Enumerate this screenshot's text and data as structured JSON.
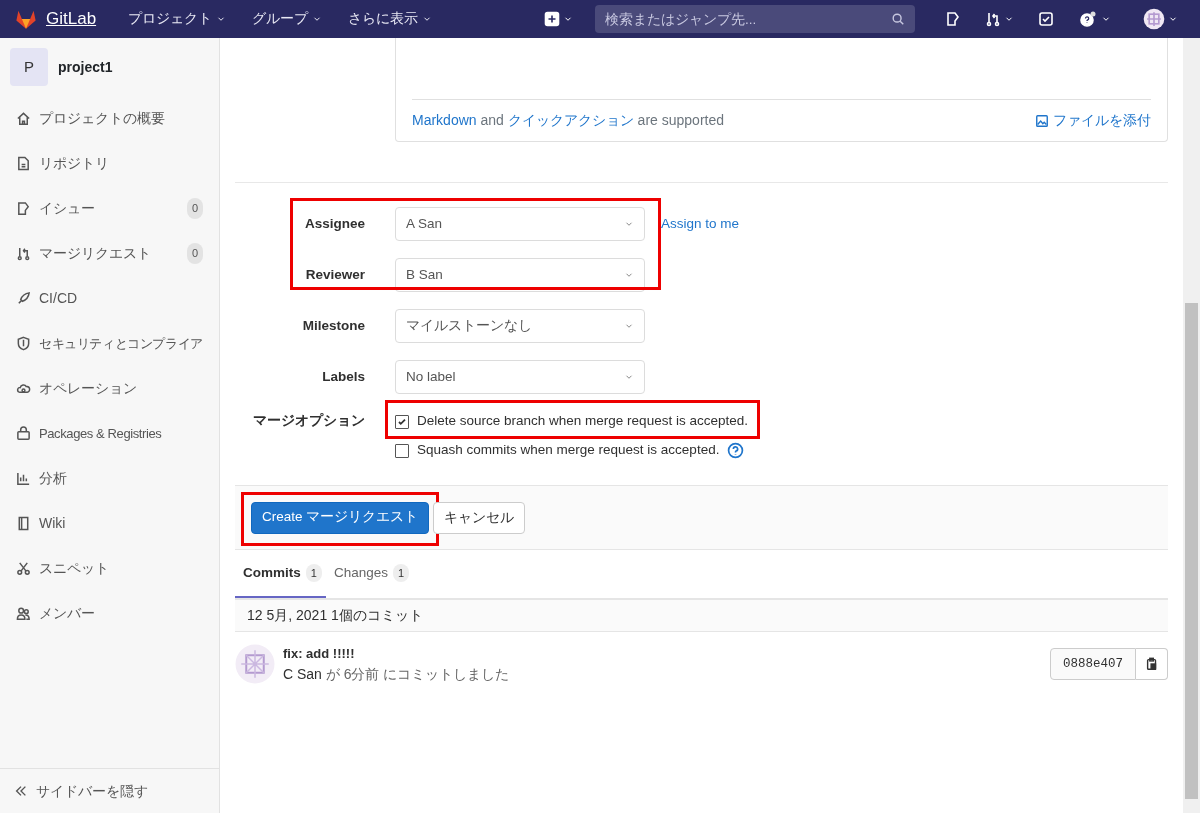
{
  "navbar": {
    "brand": "GitLab",
    "menus": [
      {
        "label": "プロジェクト"
      },
      {
        "label": "グループ"
      },
      {
        "label": "さらに表示"
      }
    ],
    "search": {
      "placeholder": "検索またはジャンプ先..."
    }
  },
  "sidebar": {
    "project": {
      "avatar": "P",
      "name": "project1"
    },
    "items": [
      {
        "label": "プロジェクトの概要"
      },
      {
        "label": "リポジトリ"
      },
      {
        "label": "イシュー",
        "count": "0"
      },
      {
        "label": "マージリクエスト",
        "count": "0"
      },
      {
        "label": "CI/CD"
      },
      {
        "label": "セキュリティとコンプライア"
      },
      {
        "label": "オペレーション"
      },
      {
        "label": "Packages & Registries"
      },
      {
        "label": "分析"
      },
      {
        "label": "Wiki"
      },
      {
        "label": "スニペット"
      },
      {
        "label": "メンバー"
      }
    ],
    "collapse": "サイドバーを隠す"
  },
  "editor_footer": {
    "segments": [
      {
        "text": "Markdown",
        "kind": "link"
      },
      {
        "text": " and ",
        "kind": "text"
      },
      {
        "text": "クイックアクション",
        "kind": "link"
      },
      {
        "text": " are supported",
        "kind": "text"
      }
    ],
    "attach": "ファイルを添付"
  },
  "field_groups": [
    {
      "highlighted": true,
      "fields": [
        {
          "label": "Assignee",
          "value": "A San",
          "action": "Assign to me"
        },
        {
          "label": "Reviewer",
          "value": "B San"
        }
      ]
    },
    {
      "highlighted": false,
      "fields": [
        {
          "label": "Milestone",
          "value": "マイルストーンなし"
        },
        {
          "label": "Labels",
          "value": "No label"
        }
      ]
    }
  ],
  "merge_options": {
    "label": "マージオプション",
    "options": [
      {
        "label": "Delete source branch when merge request is accepted.",
        "checked": true,
        "highlighted": true,
        "help": false
      },
      {
        "label": "Squash commits when merge request is accepted.",
        "checked": false,
        "highlighted": false,
        "help": true
      }
    ]
  },
  "actions": [
    {
      "label": "Create マージリクエスト",
      "kind": "primary",
      "highlighted": true
    },
    {
      "label": "キャンセル",
      "kind": "default",
      "highlighted": false
    }
  ],
  "tabs": [
    {
      "label": "Commits",
      "count": "1",
      "selected": true
    },
    {
      "label": "Changes",
      "count": "1",
      "selected": false
    }
  ],
  "commit_groups": [
    {
      "date": "12 5月, 2021 1個のコミット",
      "commits": [
        {
          "title": "fix: add !!!!!",
          "author": "C San",
          "meta": " が 6分前 にコミットしました",
          "sha": "0888e407"
        }
      ]
    }
  ]
}
